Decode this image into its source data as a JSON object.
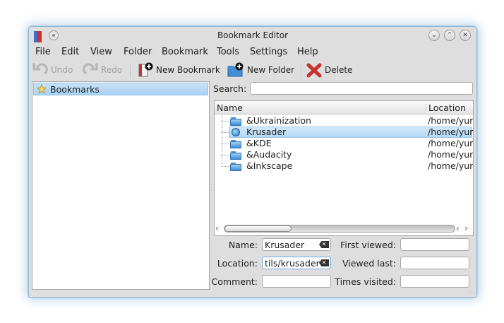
{
  "window": {
    "title": "Bookmark Editor",
    "buttons": {
      "minimize": "⌄",
      "maximize": "⌃",
      "close": "✕"
    }
  },
  "menu": [
    {
      "label": "File"
    },
    {
      "label": "Edit"
    },
    {
      "label": "View"
    },
    {
      "label": "Folder"
    },
    {
      "label": "Bookmark"
    },
    {
      "label": "Tools"
    },
    {
      "label": "Settings"
    },
    {
      "label": "Help"
    }
  ],
  "toolbar": {
    "undo_label": "Undo",
    "redo_label": "Redo",
    "new_bookmark_label": "New Bookmark",
    "new_folder_label": "New Folder",
    "delete_label": "Delete"
  },
  "tree": {
    "root_label": "Bookmarks"
  },
  "search": {
    "label": "Search:",
    "value": ""
  },
  "list": {
    "columns": [
      "Name",
      "Location"
    ],
    "rows": [
      {
        "name": "&Ukrainization",
        "location": "/home/yur",
        "icon": "folder-icon",
        "selected": false
      },
      {
        "name": "Krusader",
        "location": "/home/yur",
        "icon": "globe-icon",
        "selected": true
      },
      {
        "name": "&KDE",
        "location": "/home/yur",
        "icon": "folder-icon",
        "selected": false
      },
      {
        "name": "&Audacity",
        "location": "/home/yur",
        "icon": "folder-icon",
        "selected": false
      },
      {
        "name": "&Inkscape",
        "location": "/home/yur",
        "icon": "folder-icon",
        "selected": false
      }
    ]
  },
  "form": {
    "name_label": "Name:",
    "name_value": "Krusader",
    "location_label": "Location:",
    "location_value": "tils/krusader",
    "comment_label": "Comment:",
    "comment_value": "",
    "first_viewed_label": "First viewed:",
    "first_viewed_value": "",
    "viewed_last_label": "Viewed last:",
    "viewed_last_value": "",
    "times_visited_label": "Times visited:",
    "times_visited_value": ""
  },
  "colors": {
    "selection": "#b4d8f4",
    "window_bg": "#dedede",
    "delete_red": "#c8312e",
    "folder_blue": "#3f8ed6"
  }
}
